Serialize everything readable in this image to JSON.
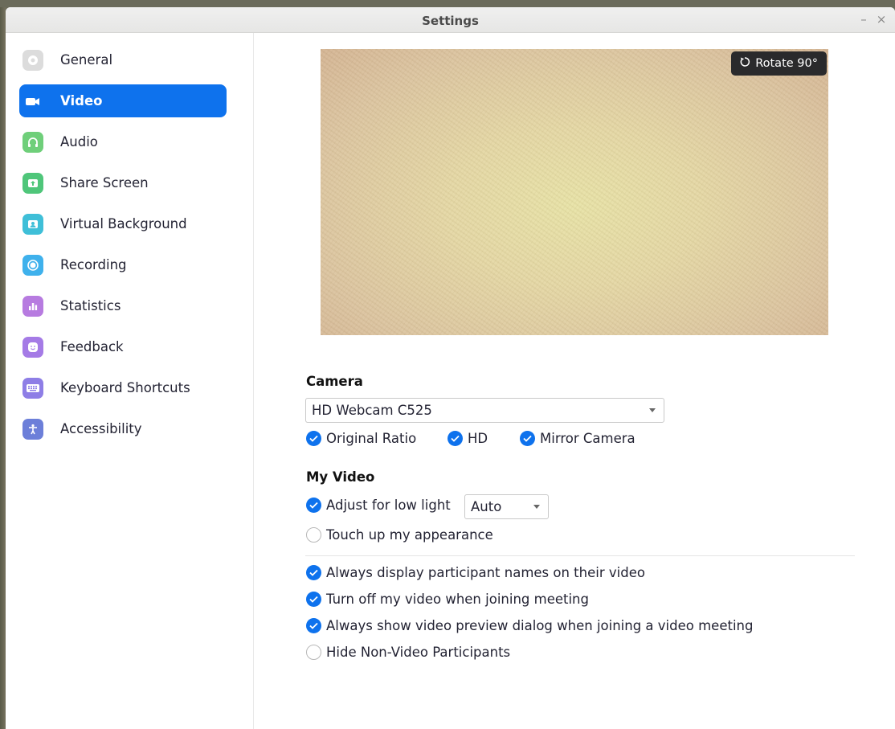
{
  "window": {
    "title": "Settings",
    "minimize_glyph": "–",
    "close_glyph": "×"
  },
  "sidebar": {
    "items": [
      {
        "label": "General",
        "icon": "gear-icon",
        "color": "#dcdcdc",
        "active": false
      },
      {
        "label": "Video",
        "icon": "video-camera-icon",
        "color": "#0e72ed",
        "active": true
      },
      {
        "label": "Audio",
        "icon": "headphones-icon",
        "color": "#6fcf7a",
        "active": false
      },
      {
        "label": "Share Screen",
        "icon": "share-screen-icon",
        "color": "#4fc67a",
        "active": false
      },
      {
        "label": "Virtual Background",
        "icon": "virtual-background-icon",
        "color": "#3fbfd8",
        "active": false
      },
      {
        "label": "Recording",
        "icon": "recording-icon",
        "color": "#3fb1ec",
        "active": false
      },
      {
        "label": "Statistics",
        "icon": "statistics-icon",
        "color": "#b77be0",
        "active": false
      },
      {
        "label": "Feedback",
        "icon": "feedback-icon",
        "color": "#a57be6",
        "active": false
      },
      {
        "label": "Keyboard Shortcuts",
        "icon": "keyboard-icon",
        "color": "#8e7ee6",
        "active": false
      },
      {
        "label": "Accessibility",
        "icon": "accessibility-icon",
        "color": "#6c7fd9",
        "active": false
      }
    ]
  },
  "video": {
    "rotate_label": "Rotate 90°",
    "camera_heading": "Camera",
    "camera_select": "HD Webcam C525",
    "camera_options": [
      {
        "label": "Original Ratio",
        "checked": true
      },
      {
        "label": "HD",
        "checked": true
      },
      {
        "label": "Mirror Camera",
        "checked": true
      }
    ],
    "my_video_heading": "My Video",
    "low_light": {
      "label": "Adjust for low light",
      "checked": true,
      "select": "Auto"
    },
    "touch_up": {
      "label": "Touch up my appearance",
      "checked": false
    },
    "options": [
      {
        "label": "Always display participant names on their video",
        "checked": true
      },
      {
        "label": "Turn off my video when joining meeting",
        "checked": true
      },
      {
        "label": "Always show video preview dialog when joining a video meeting",
        "checked": true
      },
      {
        "label": "Hide Non-Video Participants",
        "checked": false
      }
    ]
  },
  "colors": {
    "accent": "#0e72ed"
  }
}
